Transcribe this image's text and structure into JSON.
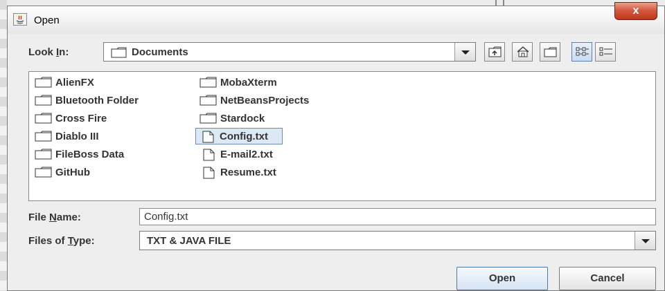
{
  "window": {
    "title": "Open",
    "close_label": "x"
  },
  "look_in": {
    "label_prefix": "Look ",
    "label_mnemonic": "I",
    "label_suffix": "n:",
    "value": "Documents"
  },
  "files": [
    {
      "name": "AlienFX",
      "type": "folder"
    },
    {
      "name": "Bluetooth Folder",
      "type": "folder"
    },
    {
      "name": "Cross Fire",
      "type": "folder"
    },
    {
      "name": "Diablo III",
      "type": "folder"
    },
    {
      "name": "FileBoss Data",
      "type": "folder"
    },
    {
      "name": "GitHub",
      "type": "folder"
    },
    {
      "name": "MobaXterm",
      "type": "folder"
    },
    {
      "name": "NetBeansProjects",
      "type": "folder"
    },
    {
      "name": "Stardock",
      "type": "folder"
    },
    {
      "name": "Config.txt",
      "type": "file",
      "selected": true
    },
    {
      "name": "E-mail2.txt",
      "type": "file"
    },
    {
      "name": "Resume.txt",
      "type": "file"
    }
  ],
  "file_name": {
    "label_prefix": "File ",
    "label_mnemonic": "N",
    "label_suffix": "ame:",
    "value": "Config.txt"
  },
  "file_type": {
    "label_prefix": "Files of ",
    "label_mnemonic": "T",
    "label_suffix": "ype:",
    "value": "TXT & JAVA FILE"
  },
  "buttons": {
    "open": "Open",
    "cancel": "Cancel"
  },
  "colors": {
    "close_button": "#c8452a",
    "selection": "#dde8f5",
    "dialog_bg": "#eeeeee"
  }
}
